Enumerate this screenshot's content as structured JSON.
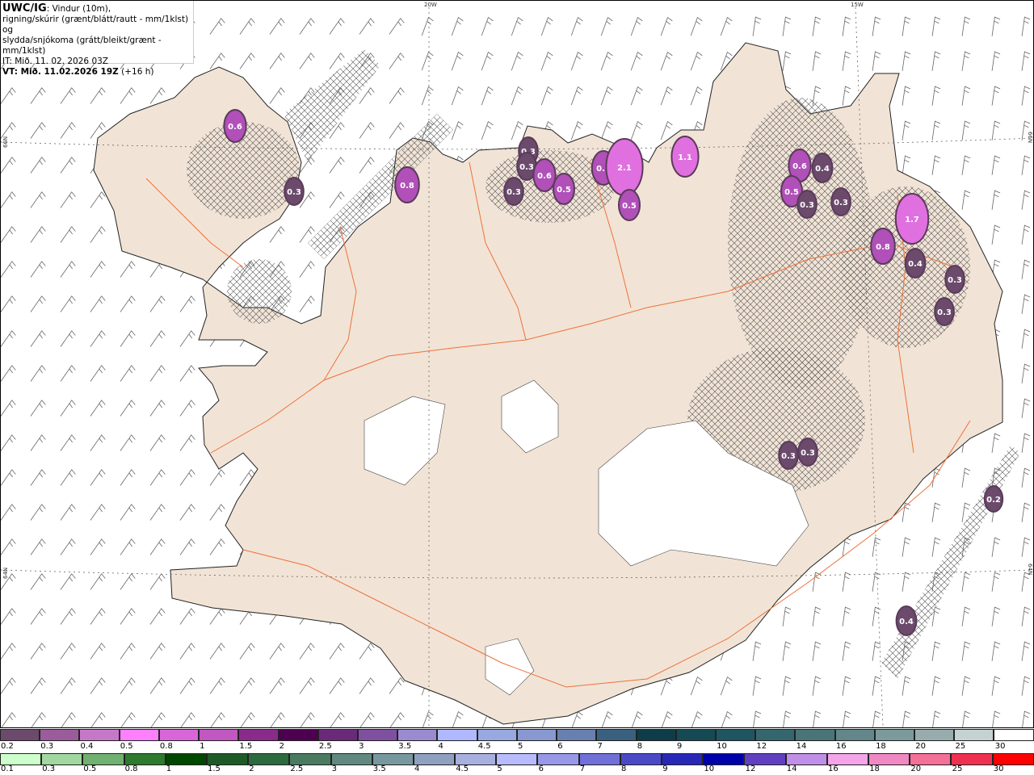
{
  "header": {
    "model": "UWC/IG",
    "line1": ": Vindur (10m),",
    "line2": "rigning/skúrir (grænt/blátt/rautt - mm/1klst) og",
    "line3": "slydda/snjókoma (grátt/bleikt/grænt - mm/1klst)",
    "it": "IT: Mið. 11. 02. 2026 03Z",
    "vt_bold": "VT: Mið. 11.02.2026 19Z",
    "vt_offset": " (+16 h)"
  },
  "grid_labels": {
    "lon_20": "20W",
    "lon_15": "15W",
    "lat_66_left": "66N",
    "lat_64_left": "64N",
    "lat_66_right": "66N",
    "lat_64_right": "64N"
  },
  "precip_labels": [
    "0.6",
    "0.8",
    "0.3",
    "0.3",
    "0.3",
    "0.6",
    "0.3",
    "0.5",
    "0.7",
    "2.1",
    "0.5",
    "1.1",
    "0.6",
    "0.4",
    "0.5",
    "0.3",
    "0.3",
    "1.7",
    "0.8",
    "0.4",
    "0.3",
    "0.3",
    "0.3",
    "0.3",
    "0.4",
    "0.2"
  ],
  "legend": {
    "snow": {
      "labels": [
        "0.2",
        "0.3",
        "0.4",
        "0.5",
        "0.8",
        "1",
        "1.5",
        "2",
        "2.5",
        "3",
        "3.5",
        "4",
        "4.5",
        "5",
        "6",
        "7",
        "8",
        "9",
        "10",
        "12",
        "14",
        "16",
        "18",
        "20",
        "25",
        "30"
      ],
      "colors": [
        "#6b4a6b",
        "#9a5c9a",
        "#c678c8",
        "#ff80ff",
        "#d966d9",
        "#c157c1",
        "#8a2a8a",
        "#4d0050",
        "#6a2a7a",
        "#8050a0",
        "#9a8ad0",
        "#b0b8ff",
        "#98a8e0",
        "#8898d0",
        "#6880b0",
        "#3a6080",
        "#0e3c48",
        "#154a55",
        "#1f5560",
        "#35666e",
        "#4a7478",
        "#62868a",
        "#7a9a9c",
        "#98acae",
        "#c4d2d2",
        "#ffffff"
      ]
    },
    "rain": {
      "labels": [
        "0.1",
        "0.3",
        "0.5",
        "0.8",
        "1",
        "1.5",
        "2",
        "2.5",
        "3",
        "3.5",
        "4",
        "4.5",
        "5",
        "6",
        "7",
        "8",
        "9",
        "10",
        "12",
        "14",
        "16",
        "18",
        "20",
        "25",
        "30"
      ],
      "colors": [
        "#ccffcc",
        "#a0d8a0",
        "#70b070",
        "#2e7a2e",
        "#004800",
        "#1e5a28",
        "#2e6a40",
        "#4a7a60",
        "#608a80",
        "#7898a0",
        "#90a0c0",
        "#a8b0e0",
        "#b8bcff",
        "#9898e8",
        "#7070d8",
        "#4a4ac8",
        "#2828b8",
        "#0000aa",
        "#6040c0",
        "#c090e8",
        "#f4a4e8",
        "#f088c4",
        "#f47098",
        "#f03050",
        "#ff0000"
      ]
    }
  }
}
